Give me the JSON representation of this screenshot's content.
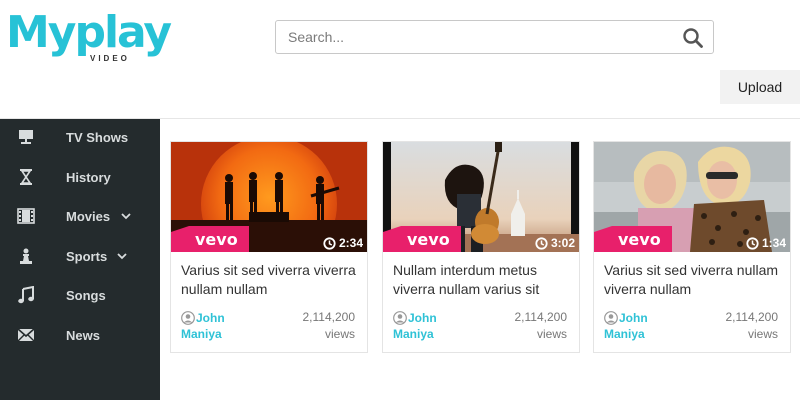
{
  "logo": {
    "main": "Myplay",
    "sub": "VIDEO"
  },
  "search": {
    "placeholder": "Search..."
  },
  "header": {
    "upload_label": "Upload"
  },
  "sidebar": {
    "items": [
      {
        "label": "TV Shows",
        "icon": "tv-icon",
        "has_dropdown": false
      },
      {
        "label": "History",
        "icon": "hourglass-icon",
        "has_dropdown": false
      },
      {
        "label": "Movies",
        "icon": "film-icon",
        "has_dropdown": true
      },
      {
        "label": "Sports",
        "icon": "chess-icon",
        "has_dropdown": true
      },
      {
        "label": "Songs",
        "icon": "music-icon",
        "has_dropdown": false
      },
      {
        "label": "News",
        "icon": "envelope-icon",
        "has_dropdown": false
      }
    ]
  },
  "videos": [
    {
      "title": "Varius sit sed viverra viverra nullam nullam",
      "duration": "2:34",
      "author_first": "John",
      "author_last": "Maniya",
      "views": "2,114,200",
      "views_label": "views",
      "badge": "vevo"
    },
    {
      "title": "Nullam interdum metus viverra nullam varius sit",
      "duration": "3:02",
      "author_first": "John",
      "author_last": "Maniya",
      "views": "2,114,200",
      "views_label": "views",
      "badge": "vevo"
    },
    {
      "title": "Varius sit sed viverra nullam viverra nullam",
      "duration": "1:34",
      "author_first": "John",
      "author_last": "Maniya",
      "views": "2,114,200",
      "views_label": "views",
      "badge": "vevo"
    }
  ],
  "colors": {
    "accent": "#27c2d6",
    "sidebar_bg": "#242b2d",
    "vevo_pink": "#e8206b"
  }
}
